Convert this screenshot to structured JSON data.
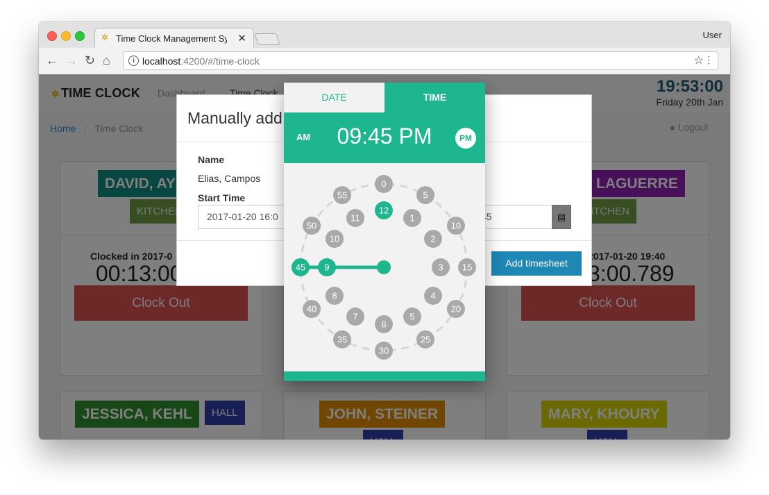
{
  "browser": {
    "tab_title": "Time Clock Management System",
    "tab_close": "✕",
    "profile": "User",
    "url_host": "localhost",
    "url_rest": ":4200/#/time-clock",
    "info_glyph": "i",
    "nav_icons": [
      "back-arrow-icon",
      "forward-arrow-icon",
      "reload-icon",
      "home-icon"
    ]
  },
  "app": {
    "logo_text": "TIME CLOCK",
    "nav_links": [
      "Dashboard",
      "Time Clock"
    ],
    "clock_time": "19:53:00",
    "clock_date": "Friday 20th Jan",
    "breadcrumb_home": "Home",
    "breadcrumb_separator": "/",
    "breadcrumb_current": "Time Clock",
    "logout": "Logout"
  },
  "employees": [
    {
      "name": "DAVID, AY",
      "dept": "KITCHEN",
      "name_color": "#0f8f85",
      "dept_color": "#6e9b45",
      "clocked_label": "Clocked in 2017-0",
      "elapsed": "00:13:00",
      "button": "Clock Out"
    },
    {
      "name": "LAGUERRE",
      "dept": "KITCHEN",
      "name_color": "#8e20b3",
      "dept_color": "#6e9b45",
      "clocked_label": "2017-01-20 19:40",
      "elapsed": "3:00.789",
      "button": "Clock Out"
    },
    {
      "name": "JESSICA, KEHL",
      "dept": "HALL",
      "name_color": "#2f8f2f",
      "dept_color": "#2f3fa8"
    },
    {
      "name": "JOHN, STEINER",
      "dept": "HALL",
      "name_color": "#e08c00",
      "dept_color": "#2f3fa8"
    },
    {
      "name": "MARY, KHOURY",
      "dept": "HALL",
      "name_color": "#d4d400",
      "dept_color": "#2f3fa8"
    }
  ],
  "modal": {
    "title": "Manually add",
    "name_label": "Name",
    "name_value": "Elias, Campos",
    "start_label": "Start Time",
    "start_value": "2017-01-20 16:0",
    "end_value_fragment": "45",
    "add_button": "Add timesheet",
    "close": "✖"
  },
  "picker": {
    "tab_date": "DATE",
    "tab_time": "TIME",
    "am": "AM",
    "pm": "PM",
    "display_time": "09:45 PM",
    "selected_hour": 9,
    "selected_minute": 45,
    "hours_inner": [
      "12",
      "1",
      "2",
      "3",
      "4",
      "5",
      "6",
      "7",
      "8",
      "9",
      "10",
      "11"
    ],
    "minutes_outer": [
      "0",
      "5",
      "10",
      "15",
      "20",
      "25",
      "30",
      "35",
      "40",
      "45",
      "50",
      "55"
    ],
    "accent_color": "#1db68f",
    "number_bg": "#a9a9a9"
  }
}
